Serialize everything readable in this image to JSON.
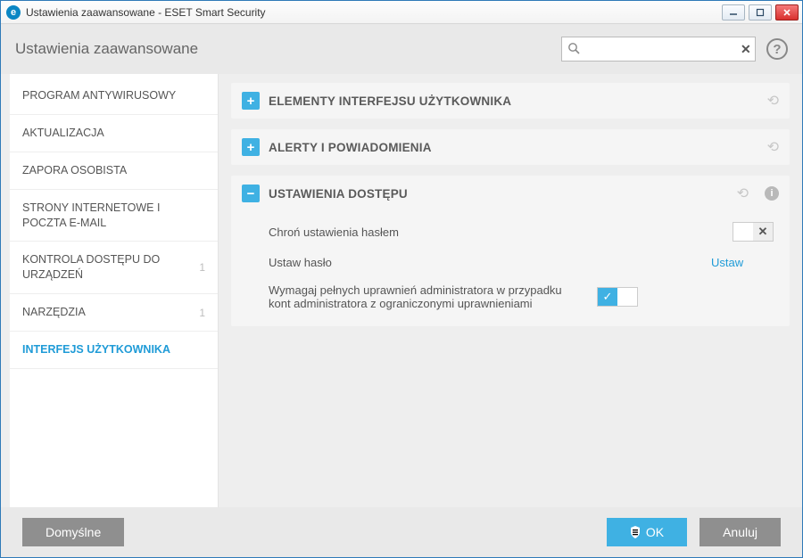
{
  "window": {
    "title": "Ustawienia zaawansowane - ESET Smart Security"
  },
  "header": {
    "title": "Ustawienia zaawansowane",
    "search_placeholder": ""
  },
  "sidebar": {
    "items": [
      {
        "label": "PROGRAM ANTYWIRUSOWY"
      },
      {
        "label": "AKTUALIZACJA"
      },
      {
        "label": "ZAPORA OSOBISTA"
      },
      {
        "label": "STRONY INTERNETOWE I POCZTA E-MAIL"
      },
      {
        "label": "KONTROLA DOSTĘPU DO URZĄDZEŃ",
        "badge": "1"
      },
      {
        "label": "NARZĘDZIA",
        "badge": "1"
      },
      {
        "label": "INTERFEJS UŻYTKOWNIKA",
        "active": true
      }
    ]
  },
  "panels": {
    "ui_elements": {
      "title": "ELEMENTY INTERFEJSU UŻYTKOWNIKA",
      "expanded": false
    },
    "alerts": {
      "title": "ALERTY I POWIADOMIENIA",
      "expanded": false
    },
    "access": {
      "title": "USTAWIENIA DOSTĘPU",
      "expanded": true,
      "rows": {
        "protect": {
          "label": "Chroń ustawienia hasłem",
          "toggle": "off",
          "off_glyph": "✕"
        },
        "set_pw": {
          "label": "Ustaw hasło",
          "link": "Ustaw"
        },
        "require_admin": {
          "label": "Wymagaj pełnych uprawnień administratora w przypadku kont administratora z ograniczonymi uprawnieniami",
          "toggle": "on",
          "on_glyph": "✓"
        }
      }
    }
  },
  "footer": {
    "default": "Domyślne",
    "ok": "OK",
    "cancel": "Anuluj"
  }
}
